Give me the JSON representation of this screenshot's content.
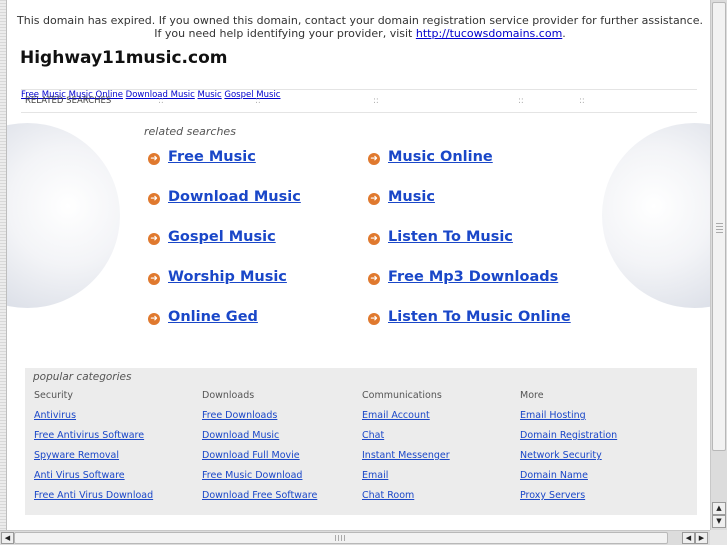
{
  "notice": {
    "text": "This domain has expired. If you owned this domain, contact your domain registration service provider for further assistance. If you need help identifying your provider, visit",
    "link": "http://tucowsdomains.com",
    "end": "."
  },
  "site_title": "Highway11music.com",
  "related_bar": {
    "label": "RELATED SEARCHES",
    "separator": "::",
    "links": [
      "Free Music",
      "Music Online",
      "Download Music",
      "Music",
      "Gospel Music"
    ]
  },
  "related": {
    "label": "related searches",
    "bullet_icon": "arrow-circle-icon",
    "left": [
      "Free Music",
      "Download Music",
      "Gospel Music",
      "Worship Music",
      "Online Ged"
    ],
    "right": [
      "Music Online",
      "Music",
      "Listen To Music",
      "Free Mp3 Downloads",
      "Listen To Music Online"
    ]
  },
  "popular": {
    "title": "popular categories",
    "columns": [
      {
        "heading": "Security",
        "links": [
          "Antivirus",
          "Free Antivirus Software",
          "Spyware Removal",
          "Anti Virus Software",
          "Free Anti Virus Download"
        ]
      },
      {
        "heading": "Downloads",
        "links": [
          "Free Downloads",
          "Download Music",
          "Download Full Movie",
          "Free Music Download",
          "Download Free Software"
        ]
      },
      {
        "heading": "Communications",
        "links": [
          "Email Account",
          "Chat",
          "Instant Messenger",
          "Email",
          "Chat Room"
        ]
      },
      {
        "heading": "More",
        "links": [
          "Email Hosting",
          "Domain Registration",
          "Network Security",
          "Domain Name",
          "Proxy Servers"
        ]
      }
    ]
  },
  "scrollbar": {
    "up": "▲",
    "down": "▼",
    "left": "◀",
    "right": "▶"
  },
  "colors": {
    "link": "#1a47c8",
    "bullet": "#e0792e",
    "panel": "#ececec"
  }
}
